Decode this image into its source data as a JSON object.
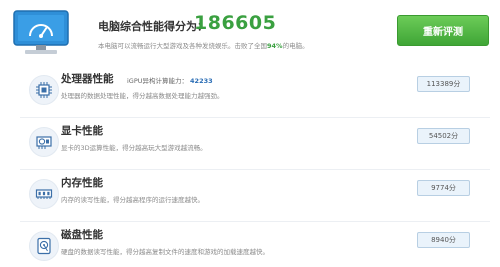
{
  "header": {
    "title": "电脑综合性能得分为：",
    "score": "186605",
    "desc_before": "本电脑可以流畅运行大型游戏及各种发烧娱乐。击败了全国",
    "desc_percent": "94%",
    "desc_after": "的电脑。",
    "retest_label": "重新评测"
  },
  "rows": [
    {
      "icon": "cpu-icon",
      "title": "处理器性能",
      "desc": "处理器的数据处理性能，得分越高数据处理能力越强劲。",
      "score": "113389分",
      "extra_label": "iGPU异构计算能力：",
      "extra_value": "42233"
    },
    {
      "icon": "graphics-card-icon",
      "title": "显卡性能",
      "desc": "显卡的3D运算性能，得分越高玩大型游戏越流畅。",
      "score": "54502分"
    },
    {
      "icon": "memory-icon",
      "title": "内存性能",
      "desc": "内存的读写性能，得分越高程序的运行速度越快。",
      "score": "9774分"
    },
    {
      "icon": "disk-icon",
      "title": "磁盘性能",
      "desc": "硬盘的数据读写性能，得分越高复制文件的速度和游戏的加载速度越快。",
      "score": "8940分"
    }
  ],
  "colors": {
    "accent_green": "#3aa040",
    "button_green": "#4cb142",
    "monitor_blue": "#2f8fd8",
    "score_box_border": "#b8cfe3",
    "link_blue": "#2a6db5"
  }
}
